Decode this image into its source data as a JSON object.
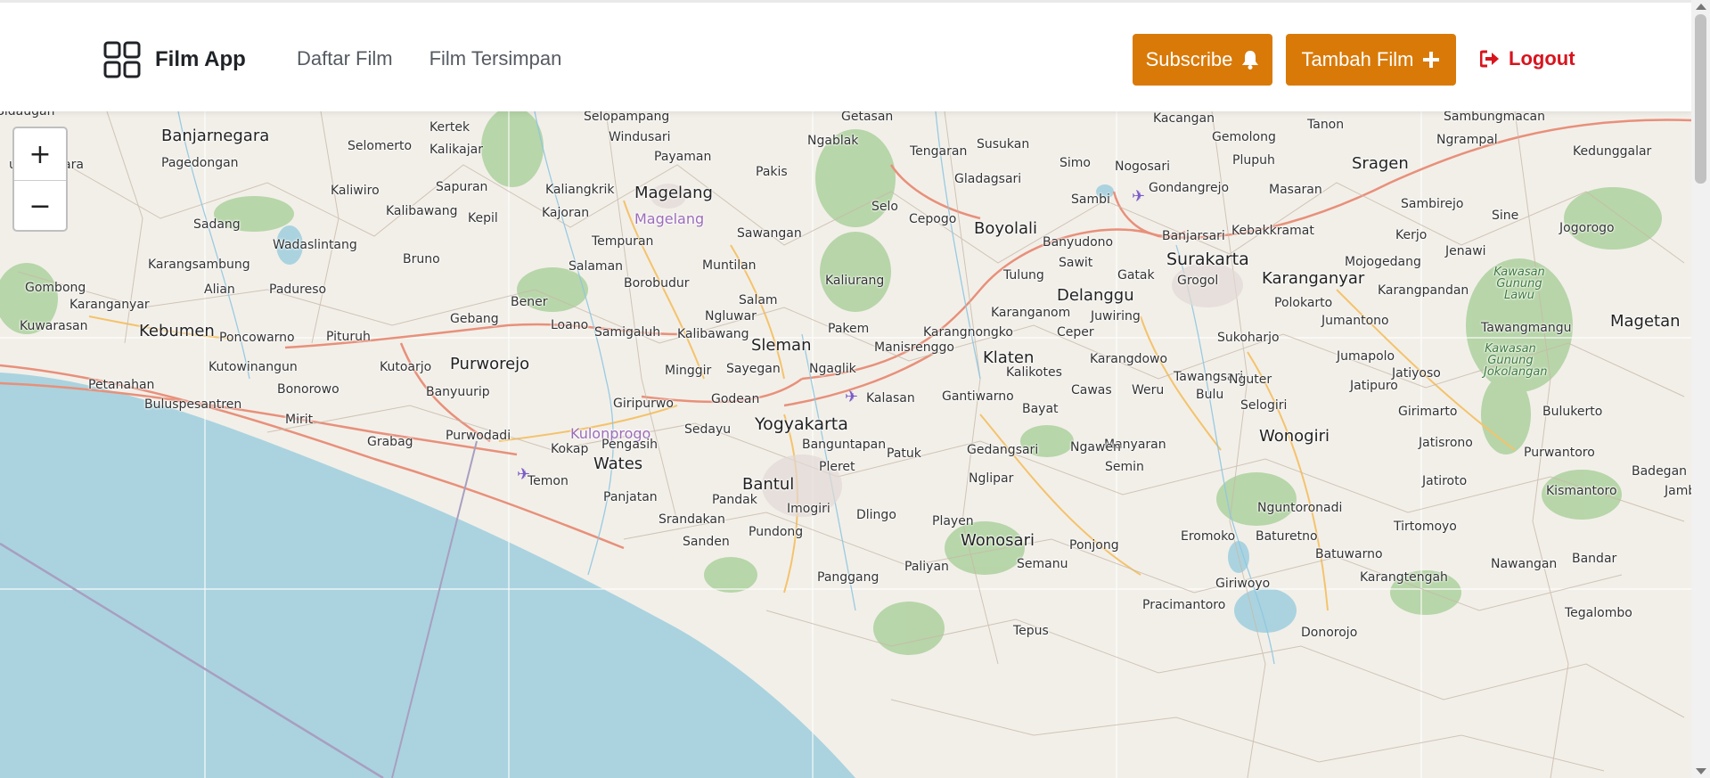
{
  "navbar": {
    "brand_name": "Film App",
    "nav_links": [
      "Daftar Film",
      "Film Tersimpan"
    ],
    "subscribe_label": "Subscribe",
    "add_film_label": "Tambah Film",
    "logout_label": "Logout"
  },
  "colors": {
    "accent": "#d97a08",
    "logout": "#d8141e",
    "sea": "#aad3df",
    "land": "#f2efe9",
    "forest": "#add19e"
  },
  "icons": {
    "brand": "grid-icon",
    "subscribe": "bell-icon",
    "add": "plus-icon",
    "logout": "sign-out-icon",
    "airport": "airplane-icon"
  },
  "map": {
    "zoom_in_label": "+",
    "zoom_out_label": "−",
    "places": {
      "banjarnegara": "Banjarnegara",
      "selomerto": "Selomerto",
      "kertek": "Kertek",
      "kalikajar": "Kalikajar",
      "selopampang": "Selopampang",
      "windusari": "Windusari",
      "payaman": "Payaman",
      "getasan": "Getasan",
      "ngablak": "Ngablak",
      "susukan": "Susukan",
      "tengaran": "Tengaran",
      "kacangan": "Kacangan",
      "gemolong": "Gemolong",
      "tanon": "Tanon",
      "sambungmacan": "Sambungmacan",
      "ngrampal": "Ngrampal",
      "kedunggalar": "Kedunggalar",
      "sragen": "Sragen",
      "purwanegara": "urwanegara",
      "pagedongan": "Pagedongan",
      "kaliwiro": "Kaliwiro",
      "sapuran": "Sapuran",
      "kaliangkrik": "Kaliangkrik",
      "magelang": "Magelang",
      "magelang_regency": "Magelang",
      "pakis": "Pakis",
      "gladagsari": "Gladagsari",
      "simo": "Simo",
      "nogosari": "Nogosari",
      "plupuh": "Plupuh",
      "gondangrejo": "Gondangrejo",
      "masaran": "Masaran",
      "sambirejo": "Sambirejo",
      "sine": "Sine",
      "jogorogo": "Jogorogo",
      "kalibawang": "Kalibawang",
      "kajoran": "Kajoran",
      "selo": "Selo",
      "cepogo": "Cepogo",
      "sambi": "Sambi",
      "sadang": "Sadang",
      "kepil": "Kepil",
      "tempuran": "Tempuran",
      "sawangan": "Sawangan",
      "boyolali": "Boyolali",
      "banyudono": "Banyudono",
      "banjarsari": "Banjarsari",
      "kebakkramat": "Kebakkramat",
      "kerjo": "Kerjo",
      "jenawi": "Jenawi",
      "wadaslintang": "Wadaslintang",
      "karangsambung": "Karangsambung",
      "bruno": "Bruno",
      "salaman": "Salaman",
      "muntilan": "Muntilan",
      "kaliurang": "Kaliurang",
      "surakarta": "Surakarta",
      "sawit": "Sawit",
      "tulung": "Tulung",
      "gatak": "Gatak",
      "mojogedang": "Mojogedang",
      "karanganyar_solo": "Karanganyar",
      "gombong": "Gombong",
      "alian": "Alian",
      "padureso": "Padureso",
      "karanganyar_keb": "Karanganyar",
      "borobudur": "Borobudur",
      "bener": "Bener",
      "salam": "Salam",
      "delanggu": "Delanggu",
      "grogol": "Grogol",
      "karangpandan": "Karangpandan",
      "polokarto": "Polokarto",
      "kawasan_lawu": "Kawasan Gunung Lawu",
      "kuwarasan": "Kuwarasan",
      "gebang": "Gebang",
      "loano": "Loano",
      "samigaluh": "Samigaluh",
      "ngluwar": "Ngluwar",
      "karanganom": "Karanganom",
      "juwiring": "Juwiring",
      "jumantono": "Jumantono",
      "magetan": "Magetan",
      "kebumen": "Kebumen",
      "poncowarno": "Poncowarno",
      "pituruh": "Pituruh",
      "kalibawang2": "Kalibawang",
      "sleman": "Sleman",
      "pakem": "Pakem",
      "karangnongko": "Karangnongko",
      "ceper": "Ceper",
      "sukoharjo": "Sukoharjo",
      "tawangmangu": "Tawangmangu",
      "manisrenggo": "Manisrenggo",
      "jumapolo": "Jumapolo",
      "kawasan_jokolangan": "Kawasan Gunung Jokolangan",
      "kutowinangun": "Kutowinangun",
      "kutoarjo": "Kutoarjo",
      "purworejo": "Purworejo",
      "minggir": "Minggir",
      "sayegan": "Sayegan",
      "ngaglik": "Ngaglik",
      "klaten": "Klaten",
      "karangdowo": "Karangdowo",
      "kalikotes": "Kalikotes",
      "tawangsari": "Tawangsari",
      "jatiyoso": "Jatiyoso",
      "petanahan": "Petanahan",
      "bonorowo": "Bonorowo",
      "banyuurip": "Banyuurip",
      "bulupesantren": "Buluspesantren",
      "giripurwo": "Giripurwo",
      "godean": "Godean",
      "kalasan": "Kalasan",
      "gantiwarno": "Gantiwarno",
      "cawas": "Cawas",
      "weru": "Weru",
      "bulu": "Bulu",
      "nguter": "Nguter",
      "jatipuro": "Jatipuro",
      "selogiri": "Selogiri",
      "bayat": "Bayat",
      "girimarto": "Girimarto",
      "bulukerto": "Bulukerto",
      "mirit": "Mirit",
      "yogyakarta": "Yogyakarta",
      "grabag": "Grabag",
      "purwodadi": "Purwodadi",
      "kulonprogo": "Kulonprogo",
      "sedayu": "Sedayu",
      "banguntapan": "Banguntapan",
      "manyaran": "Manyaran",
      "wonogiri": "Wonogiri",
      "jatisrono": "Jatisrono",
      "kokap": "Kokap",
      "pengasih": "Pengasih",
      "gedangsari": "Gedangsari",
      "ngawen": "Ngawen",
      "purwantoro": "Purwantoro",
      "wates": "Wates",
      "patuk": "Patuk",
      "semin": "Semin",
      "badegan": "Badegan",
      "pleret": "Pleret",
      "temon": "Temon",
      "bantul": "Bantul",
      "nglipar": "Nglipar",
      "jatiroto": "Jatiroto",
      "kismantoro": "Kismantoro",
      "jamb": "Jamb",
      "panjatan": "Panjatan",
      "pandak": "Pandak",
      "imogiri": "Imogiri",
      "nguntoronadi": "Nguntoronadi",
      "srandakan": "Srandakan",
      "dlingo": "Dlingo",
      "playen": "Playen",
      "tirtomoyo": "Tirtomoyo",
      "eromoko": "Eromoko",
      "baturetno": "Baturetno",
      "pundong": "Pundong",
      "wonosari": "Wonosari",
      "sanden": "Sanden",
      "ponjong": "Ponjong",
      "batuwarno": "Batuwarno",
      "nawangan": "Nawangan",
      "bandar": "Bandar",
      "semanu": "Semanu",
      "paliyan": "Paliyan",
      "panggang": "Panggang",
      "giriwoyo": "Giriwoyo",
      "karangtengah": "Karangtengah",
      "pracimantoro": "Pracimantoro",
      "tegalombo": "Tegalombo",
      "tepus": "Tepus",
      "donorojo": "Donorojo"
    }
  }
}
